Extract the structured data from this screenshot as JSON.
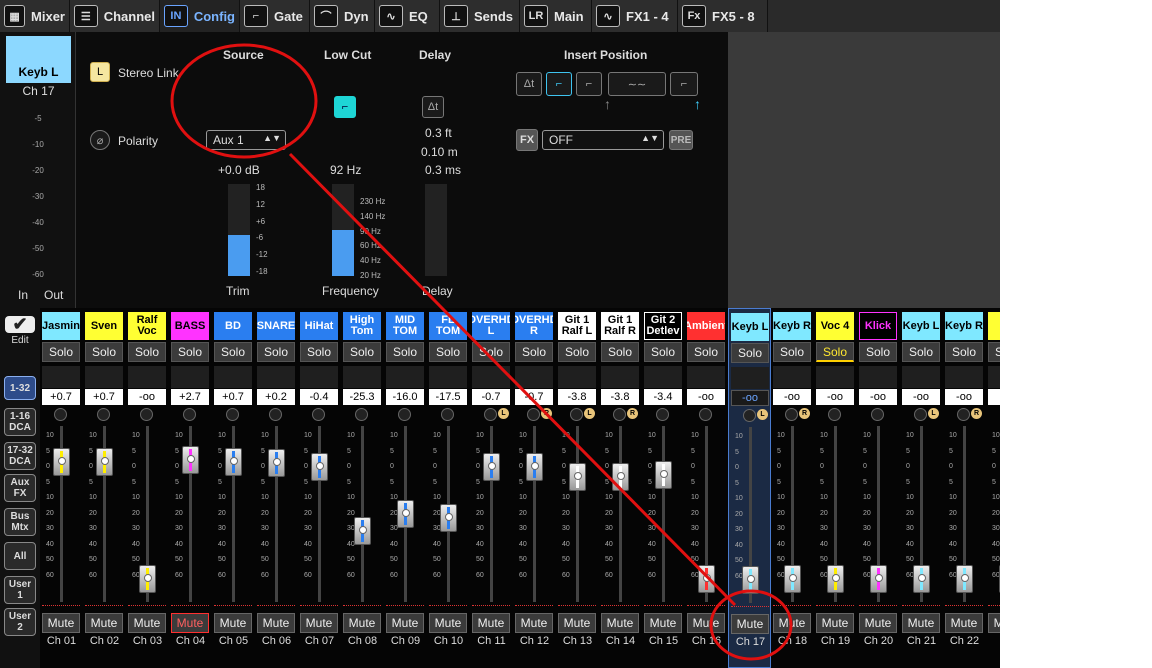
{
  "tabs": [
    {
      "label": "Mixer",
      "icon": "mixer-icon",
      "glyph": "▦"
    },
    {
      "label": "Channel",
      "icon": "channel-icon",
      "glyph": "☰"
    },
    {
      "label": "Config",
      "icon": "config-icon",
      "glyph": "IN"
    },
    {
      "label": "Gate",
      "icon": "gate-icon",
      "glyph": "⌐"
    },
    {
      "label": "Dyn",
      "icon": "dyn-icon",
      "glyph": "⌒"
    },
    {
      "label": "EQ",
      "icon": "eq-icon",
      "glyph": "∿"
    },
    {
      "label": "Sends",
      "icon": "sends-icon",
      "glyph": "⊥"
    },
    {
      "label": "Main",
      "icon": "main-icon",
      "glyph": "LR"
    },
    {
      "label": "FX1 - 4",
      "icon": "fx14-icon",
      "glyph": "∿"
    },
    {
      "label": "FX5 - 8",
      "icon": "fx58-icon",
      "glyph": "Fx"
    }
  ],
  "active_tab": "Config",
  "selected_channel": {
    "name": "Keyb L",
    "number": "Ch 17",
    "scale": [
      "-5",
      "-10",
      "-20",
      "-30",
      "-40",
      "-50",
      "-60"
    ],
    "in_label": "In",
    "out_label": "Out"
  },
  "config": {
    "stereo_link_label": "Stereo Link",
    "stereo_link_button": "L",
    "polarity_label": "Polarity",
    "source": {
      "header": "Source",
      "value": "Aux 1",
      "gain": "+0.0 dB",
      "meter_label": "Trim",
      "ticks": [
        "18",
        "12",
        "+6",
        "-6",
        "-12",
        "-18"
      ],
      "level": 0.45
    },
    "low_cut": {
      "header": "Low Cut",
      "freq": "92 Hz",
      "meter_label": "Frequency",
      "ticks": [
        "230 Hz",
        "140 Hz",
        "90 Hz",
        "60 Hz",
        "40 Hz",
        "20 Hz"
      ],
      "level": 0.5
    },
    "delay": {
      "header": "Delay",
      "ft": "0.3 ft",
      "m": "0.10 m",
      "ms": "0.3 ms",
      "meter_label": "Delay",
      "glyph": "Δt"
    },
    "insert": {
      "header": "Insert Position",
      "fx_value": "OFF",
      "pre_label": "PRE",
      "fx_label": "FX"
    }
  },
  "sidebar": [
    "Edit",
    "1-32",
    "1-16 DCA",
    "17-32 DCA",
    "Aux FX",
    "Bus Mtx",
    "All",
    "User 1",
    "User 2"
  ],
  "sidebar_selected": "1-32",
  "channels": [
    {
      "name": "Jasmin",
      "color": "#7fe8ff",
      "gain": "+0.7",
      "level": 0.79,
      "stripe": "#ffee00",
      "ch": "Ch 01"
    },
    {
      "name": "Sven",
      "color": "#ffff33",
      "gain": "+0.7",
      "level": 0.79,
      "stripe": "#ffee00",
      "ch": "Ch 02"
    },
    {
      "name": "Ralf Voc",
      "color": "#ffff33",
      "gain": "-oo",
      "level": 0.1,
      "stripe": "#ffee00",
      "ch": "Ch 03"
    },
    {
      "name": "BASS",
      "color": "#ff33ff",
      "gain": "+2.7",
      "level": 0.8,
      "stripe": "#ff33ff",
      "ch": "Ch 04",
      "mute": true
    },
    {
      "name": "BD",
      "color": "#2a7ef0",
      "gain": "+0.7",
      "level": 0.79,
      "stripe": "#2a7ef0",
      "ch": "Ch 05"
    },
    {
      "name": "SNARE",
      "color": "#2a7ef0",
      "gain": "+0.2",
      "level": 0.78,
      "stripe": "#2a7ef0",
      "ch": "Ch 06"
    },
    {
      "name": "HiHat",
      "color": "#2a7ef0",
      "gain": "-0.4",
      "level": 0.76,
      "stripe": "#2a7ef0",
      "ch": "Ch 07"
    },
    {
      "name": "High Tom",
      "color": "#2a7ef0",
      "gain": "-25.3",
      "level": 0.38,
      "stripe": "#2a7ef0",
      "ch": "Ch 08"
    },
    {
      "name": "MID TOM",
      "color": "#2a7ef0",
      "gain": "-16.0",
      "level": 0.48,
      "stripe": "#2a7ef0",
      "ch": "Ch 09"
    },
    {
      "name": "FL TOM",
      "color": "#2a7ef0",
      "gain": "-17.5",
      "level": 0.46,
      "stripe": "#2a7ef0",
      "ch": "Ch 10"
    },
    {
      "name": "OVERHD L",
      "color": "#2a7ef0",
      "gain": "-0.7",
      "level": 0.76,
      "stripe": "#2a7ef0",
      "ch": "Ch 11",
      "lr": "L"
    },
    {
      "name": "OVERHD R",
      "color": "#2a7ef0",
      "gain": "-0.7",
      "level": 0.76,
      "stripe": "#2a7ef0",
      "ch": "Ch 12",
      "lr": "R"
    },
    {
      "name": "Git 1 Ralf L",
      "color": "#ffffff",
      "gain": "-3.8",
      "level": 0.7,
      "stripe": "#ffffff",
      "ch": "Ch 13",
      "lr": "L"
    },
    {
      "name": "Git 1 Ralf R",
      "color": "#ffffff",
      "gain": "-3.8",
      "level": 0.7,
      "stripe": "#ffffff",
      "ch": "Ch 14",
      "lr": "R"
    },
    {
      "name": "Git 2 Detlev",
      "color": "#ffffff",
      "gain": "-3.4",
      "level": 0.71,
      "stripe": "#ffffff",
      "ch": "Ch 15"
    },
    {
      "name": "Ambient",
      "color": "#ff3030",
      "gain": "-oo",
      "level": 0.1,
      "stripe": "#ff3030",
      "ch": "Ch 16"
    },
    {
      "name": "Keyb L",
      "color": "#7fe8ff",
      "gain": "-oo",
      "level": 0.1,
      "stripe": "#7fe8ff",
      "ch": "Ch 17",
      "lr": "L",
      "selected": true
    },
    {
      "name": "Keyb R",
      "color": "#7fe8ff",
      "gain": "-oo",
      "level": 0.1,
      "stripe": "#7fe8ff",
      "ch": "Ch 18",
      "lr": "R"
    },
    {
      "name": "Voc 4",
      "color": "#ffff33",
      "gain": "-oo",
      "level": 0.1,
      "stripe": "#ffee00",
      "ch": "Ch 19",
      "solo": true
    },
    {
      "name": "Klick",
      "color": "#000000",
      "text": "#ff33ff",
      "gain": "-oo",
      "level": 0.1,
      "stripe": "#ff33ff",
      "ch": "Ch 20"
    },
    {
      "name": "Keyb L",
      "color": "#7fe8ff",
      "gain": "-oo",
      "level": 0.1,
      "stripe": "#7fe8ff",
      "ch": "Ch 21",
      "lr": "L"
    },
    {
      "name": "Keyb R",
      "color": "#7fe8ff",
      "gain": "-oo",
      "level": 0.1,
      "stripe": "#7fe8ff",
      "ch": "Ch 22",
      "lr": "R"
    },
    {
      "name": "V",
      "color": "#ffff33",
      "gain": "",
      "level": 0.1,
      "stripe": "#ffee00",
      "ch": "C"
    }
  ],
  "solo_label": "Solo",
  "mute_label": "Mute",
  "fader_scale": [
    "10",
    "5",
    "0",
    "5",
    "10",
    "20",
    "30",
    "40",
    "50",
    "60"
  ],
  "annotation_color": "#e01010"
}
